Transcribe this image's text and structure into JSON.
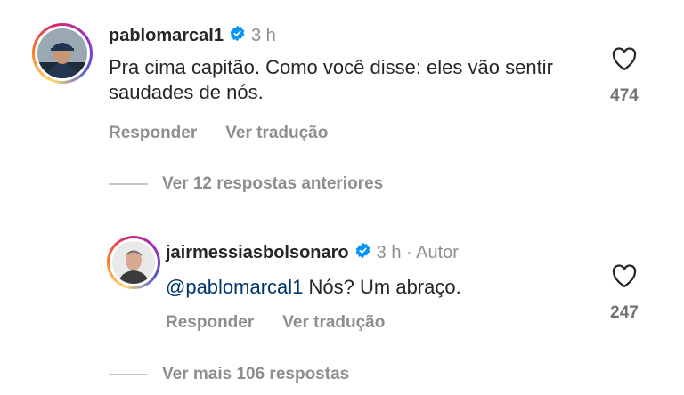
{
  "comment1": {
    "username": "pablomarcal1",
    "time": "3 h",
    "text": "Pra cima capitão. Como você disse: eles vão sentir saudades de nós.",
    "reply_label": "Responder",
    "translate_label": "Ver tradução",
    "like_count": "474"
  },
  "thread": {
    "previous_replies": "Ver 12 respostas anteriores"
  },
  "comment2": {
    "username": "jairmessiasbolsonaro",
    "time": "3 h · Autor",
    "mention": "@pablomarcal1",
    "text": " Nós? Um abraço.",
    "reply_label": "Responder",
    "translate_label": "Ver tradução",
    "like_count": "247"
  },
  "more_replies": "Ver mais 106 respostas",
  "colors": {
    "verified": "#0095f6",
    "muted": "#8e8e8e",
    "mention": "#00376b"
  }
}
